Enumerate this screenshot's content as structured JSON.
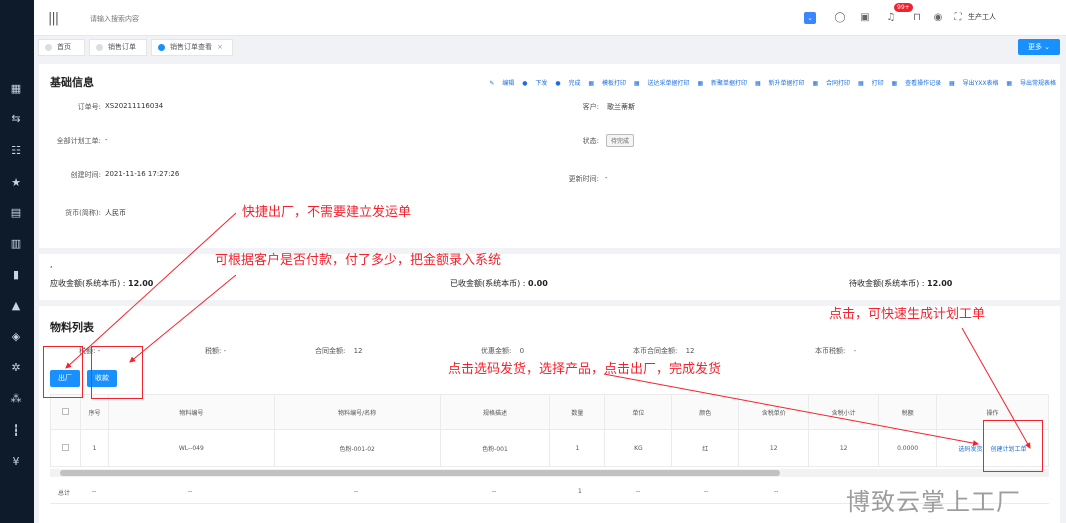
{
  "header": {
    "search_placeholder": "请输入搜索内容",
    "notification_badge": "99+",
    "user_name": "生产工人"
  },
  "tabs": [
    {
      "label": "首页"
    },
    {
      "label": "销售订单"
    },
    {
      "label": "销售订单查看",
      "close": "×"
    }
  ],
  "more_button": "更多 ⌄",
  "basic_info": {
    "title": "基础信息",
    "actions": [
      "编辑",
      "下发",
      "完成",
      "模板打印",
      "送达采单据打印",
      "新聚单据打印",
      "新升单据打印",
      "合同打印",
      "打印",
      "查看操作记录",
      "导出YXX表格",
      "导出常规表格"
    ],
    "action_icons": [
      "edit-icon",
      "send-icon",
      "check-icon",
      "print-icon",
      "print-icon",
      "print-icon",
      "print-icon",
      "print-icon",
      "print-icon",
      "history-icon",
      "export-icon",
      "export-icon"
    ],
    "fields": {
      "order_no_label": "订单号:",
      "order_no": "XS20211116034",
      "customer_label": "客户:",
      "customer": "歌兰蒂斯",
      "plan_label": "全部计划工单:",
      "plan": "-",
      "status_label": "状态:",
      "status": "待完成",
      "created_label": "创建时间:",
      "created": "2021-11-16 17:27:26",
      "updated_label": "更新时间:",
      "updated": "-",
      "currency_label": "货币(简称):",
      "currency": "人民币"
    }
  },
  "amounts": {
    "dot": ",",
    "receivable_label": "应收金额(系统本币) :",
    "receivable": "12.00",
    "received_label": "已收金额(系统本币) :",
    "received": "0.00",
    "pending_label": "待收金额(系统本币) :",
    "pending": "12.00"
  },
  "materials": {
    "title": "物料列表",
    "summary": {
      "price_label": "税额:",
      "price": "-",
      "tax_label": "税额:",
      "tax": "-",
      "contract_label": "合同金额:",
      "contract": "12",
      "discount_label": "优惠金额:",
      "discount": "0",
      "local_contract_label": "本币合同金额:",
      "local_contract": "12",
      "local_tax_label": "本币税额:",
      "local_tax": "-"
    },
    "ship_button": "出厂",
    "collect_button": "收款",
    "columns": [
      "序号",
      "物料编号",
      "物料编号/名称",
      "规格描述",
      "数量",
      "单位",
      "颜色",
      "含税单价",
      "含税小计",
      "税额",
      "操作"
    ],
    "rows": [
      {
        "no": "1",
        "code": "WL--049",
        "name": "色粉-001-02",
        "spec": "色粉-001",
        "qty": "1",
        "unit": "KG",
        "color": "红",
        "unit_price": "12",
        "subtotal": "12",
        "tax": "0.0000",
        "op1": "选码发货",
        "op2": "创建计划工单"
      }
    ],
    "totals": {
      "label": "总计",
      "dash": "--",
      "qty": "1"
    }
  },
  "annotations": {
    "quick_ship": "快捷出厂，不需要建立发运单",
    "payment": "可根据客户是否付款，付了多少，把金额录入系统",
    "plan_order": "点击，可快速生成计划工单",
    "select_ship": "点击选码发货，选择产品，点击出厂，完成发货"
  },
  "watermark": "博致云掌上工厂",
  "colors": {
    "sidebar": "#0d1b2a",
    "primary": "#1890ff",
    "annotation": "#f5222d"
  }
}
